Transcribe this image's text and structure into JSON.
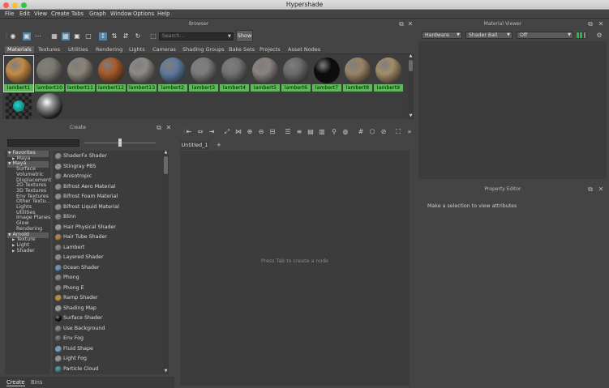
{
  "window": {
    "title": "Hypershade"
  },
  "menu": [
    "File",
    "Edit",
    "View",
    "Create",
    "Tabs",
    "Graph",
    "Window",
    "Options",
    "Help"
  ],
  "browser": {
    "title": "Browser",
    "search_placeholder": "Search...",
    "show_label": "Show",
    "tabs": [
      "Materials",
      "Textures",
      "Utilities",
      "Rendering",
      "Lights",
      "Cameras",
      "Shading Groups",
      "Bake Sets",
      "Projects",
      "Asset Nodes"
    ],
    "materials": [
      {
        "label": "lambert1",
        "color": "#c48a45"
      },
      {
        "label": "lambert10",
        "color": "#7d7770"
      },
      {
        "label": "lambert11",
        "color": "#8b8379"
      },
      {
        "label": "lambert12",
        "color": "#a65a2a"
      },
      {
        "label": "lambert13",
        "color": "#8e8a84"
      },
      {
        "label": "lambert2",
        "color": "#5f7a9e"
      },
      {
        "label": "lambert3",
        "color": "#7b7b7b"
      },
      {
        "label": "lambert4",
        "color": "#727272"
      },
      {
        "label": "lambert5",
        "color": "#8a8380"
      },
      {
        "label": "lambert6",
        "color": "#6a6a6a"
      },
      {
        "label": "lambert7",
        "color": "#0b0b0b"
      },
      {
        "label": "lambert8",
        "color": "#9a8366"
      },
      {
        "label": "lambert9",
        "color": "#a48c6a"
      }
    ]
  },
  "material_viewer": {
    "title": "Material Viewer",
    "renderer": "Hardware",
    "geometry": "Shader Ball",
    "mode": "Off"
  },
  "create_panel": {
    "title": "Create",
    "tree": [
      {
        "label": "Favorites",
        "level": 0,
        "header": true
      },
      {
        "label": "Maya",
        "level": 1,
        "header": false
      },
      {
        "label": "Maya",
        "level": 0,
        "header": true
      },
      {
        "label": "Surface",
        "level": 2,
        "header": false
      },
      {
        "label": "Volumetric",
        "level": 2,
        "header": false
      },
      {
        "label": "Displacement",
        "level": 2,
        "header": false
      },
      {
        "label": "2D Textures",
        "level": 2,
        "header": false
      },
      {
        "label": "3D Textures",
        "level": 2,
        "header": false
      },
      {
        "label": "Env Textures",
        "level": 2,
        "header": false
      },
      {
        "label": "Other Textu...",
        "level": 2,
        "header": false
      },
      {
        "label": "Lights",
        "level": 2,
        "header": false
      },
      {
        "label": "Utilities",
        "level": 2,
        "header": false
      },
      {
        "label": "Image Planes",
        "level": 2,
        "header": false
      },
      {
        "label": "Glow",
        "level": 2,
        "header": false
      },
      {
        "label": "Rendering",
        "level": 2,
        "header": false
      },
      {
        "label": "Arnold",
        "level": 0,
        "header": true
      },
      {
        "label": "Texture",
        "level": 1,
        "header": false
      },
      {
        "label": "Light",
        "level": 1,
        "header": false
      },
      {
        "label": "Shader",
        "level": 1,
        "header": false
      }
    ],
    "nodes": [
      {
        "label": "ShaderFx Shader",
        "color": "#8a8a8a"
      },
      {
        "label": "Stingray PBS",
        "color": "#9a9a9a"
      },
      {
        "label": "Anisotropic",
        "color": "#7a7a7a"
      },
      {
        "label": "Bifrost Aero Material",
        "color": "#8e8e8e"
      },
      {
        "label": "Bifrost Foam Material",
        "color": "#8e8e8e"
      },
      {
        "label": "Bifrost Liquid Material",
        "color": "#8e8e8e"
      },
      {
        "label": "Blinn",
        "color": "#7d7d7d"
      },
      {
        "label": "Hair Physical Shader",
        "color": "#9b9b9b"
      },
      {
        "label": "Hair Tube Shader",
        "color": "#b07a44"
      },
      {
        "label": "Lambert",
        "color": "#7a7a7a"
      },
      {
        "label": "Layered Shader",
        "color": "#8a8a8a"
      },
      {
        "label": "Ocean Shader",
        "color": "#5b90c0"
      },
      {
        "label": "Phong",
        "color": "#7d7d7d"
      },
      {
        "label": "Phong E",
        "color": "#7d7d7d"
      },
      {
        "label": "Ramp Shader",
        "color": "#c3902f"
      },
      {
        "label": "Shading Map",
        "color": "#a0a0a0"
      },
      {
        "label": "Surface Shader",
        "color": "#0c0c0c"
      },
      {
        "label": "Use Background",
        "color": "#777777"
      },
      {
        "label": "Env Fog",
        "color": "#5e5e5e"
      },
      {
        "label": "Fluid Shape",
        "color": "#6da8d6"
      },
      {
        "label": "Light Fog",
        "color": "#9a9a9a"
      },
      {
        "label": "Particle Cloud",
        "color": "#2e8a8a"
      }
    ]
  },
  "graph": {
    "tab": "Untitled_1",
    "add_tab": "+",
    "hint": "Press Tab to create a node"
  },
  "property_editor": {
    "title": "Property Editor",
    "hint": "Make a selection to view attributes"
  },
  "bottom_tabs": [
    "Create",
    "Bins"
  ]
}
